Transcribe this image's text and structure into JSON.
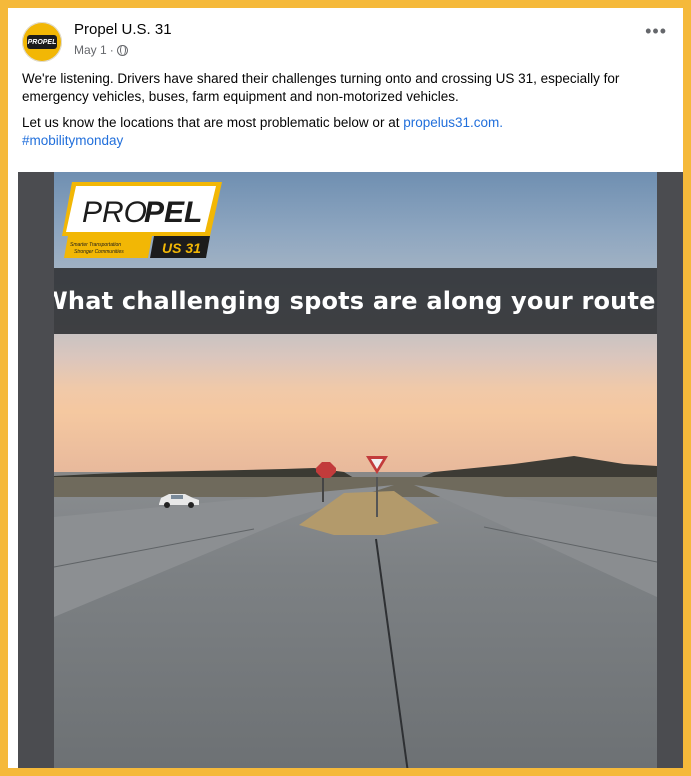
{
  "post": {
    "page_name": "Propel U.S. 31",
    "date": "May 1",
    "separator": "·",
    "more_label": "•••",
    "paragraph1": "We're listening. Drivers have shared their challenges turning onto and crossing US 31, especially for emergency vehicles, buses, farm equipment and non-motorized vehicles.",
    "paragraph2_prefix": "Let us know the locations that are most problematic below or at ",
    "link": "propelus31.com.",
    "hashtag": "#mobilitymonday"
  },
  "image": {
    "banner_text": "What challenging spots are along your route?",
    "logo": {
      "brand_light": "PRO",
      "brand_bold": "PEL",
      "tagline_line1": "Smarter Transportation",
      "tagline_line2": "Stronger Communities",
      "route": "US 31"
    }
  },
  "avatar": {
    "text": "PROPEL"
  },
  "colors": {
    "frame": "#f5b93a",
    "link": "#216fdb",
    "brand_yellow": "#f2b705",
    "banner_bg": "#323437"
  }
}
